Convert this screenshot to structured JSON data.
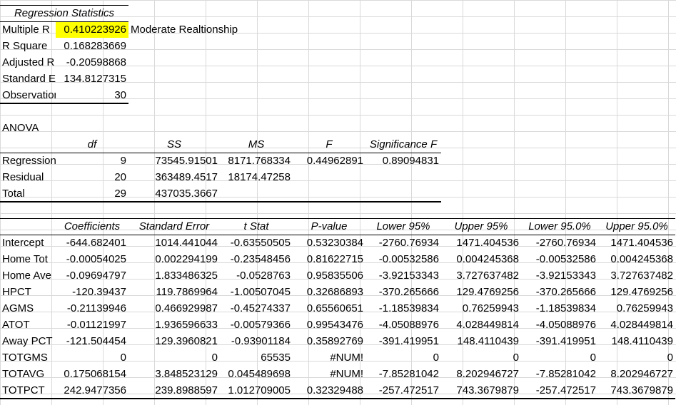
{
  "regression_statistics": {
    "title": "Regression Statistics",
    "rows": [
      {
        "label": "Multiple R",
        "value": "0.410223926",
        "note": "Moderate Realtionship"
      },
      {
        "label": "R Square",
        "value": "0.168283669"
      },
      {
        "label": "Adjusted R Square",
        "value": "-0.20598868"
      },
      {
        "label": "Standard Error",
        "value": "134.8127315"
      },
      {
        "label": "Observations",
        "value": "30"
      }
    ]
  },
  "anova": {
    "title": "ANOVA",
    "headers": [
      "df",
      "SS",
      "MS",
      "F",
      "Significance F"
    ],
    "rows": [
      {
        "label": "Regression",
        "df": "9",
        "ss": "73545.91501",
        "ms": "8171.768334",
        "f": "0.44962891",
        "sig": "0.89094831"
      },
      {
        "label": "Residual",
        "df": "20",
        "ss": "363489.4517",
        "ms": "18174.47258"
      },
      {
        "label": "Total",
        "df": "29",
        "ss": "437035.3667"
      }
    ]
  },
  "coefficients": {
    "headers": [
      "Coefficients",
      "Standard Error",
      "t Stat",
      "P-value",
      "Lower 95%",
      "Upper 95%",
      "Lower 95.0%",
      "Upper 95.0%"
    ],
    "rows": [
      {
        "label": "Intercept",
        "values": [
          "-644.682401",
          "1014.441044",
          "-0.63550505",
          "0.53230384",
          "-2760.76934",
          "1471.404536",
          "-2760.76934",
          "1471.404536"
        ]
      },
      {
        "label": "Home Tot",
        "values": [
          "-0.00054025",
          "0.002294199",
          "-0.23548456",
          "0.81622715",
          "-0.00532586",
          "0.004245368",
          "-0.00532586",
          "0.004245368"
        ]
      },
      {
        "label": "Home Ave",
        "values": [
          "-0.09694797",
          "1.833486325",
          "-0.0528763",
          "0.95835506",
          "-3.92153343",
          "3.727637482",
          "-3.92153343",
          "3.727637482"
        ]
      },
      {
        "label": "HPCT",
        "values": [
          "-120.39437",
          "119.7869964",
          "-1.00507045",
          "0.32686893",
          "-370.265666",
          "129.4769256",
          "-370.265666",
          "129.4769256"
        ]
      },
      {
        "label": "AGMS",
        "values": [
          "-0.21139946",
          "0.466929987",
          "-0.45274337",
          "0.65560651",
          "-1.18539834",
          "0.76259943",
          "-1.18539834",
          "0.76259943"
        ]
      },
      {
        "label": "ATOT",
        "values": [
          "-0.01121997",
          "1.936596633",
          "-0.00579366",
          "0.99543476",
          "-4.05088976",
          "4.028449814",
          "-4.05088976",
          "4.028449814"
        ]
      },
      {
        "label": "Away PCT",
        "values": [
          "-121.504454",
          "129.3960821",
          "-0.93901184",
          "0.35892769",
          "-391.419951",
          "148.4110439",
          "-391.419951",
          "148.4110439"
        ]
      },
      {
        "label": "TOTGMS",
        "values": [
          "0",
          "0",
          "65535",
          "#NUM!",
          "0",
          "0",
          "0",
          "0"
        ]
      },
      {
        "label": "TOTAVG",
        "values": [
          "0.175068154",
          "3.848523129",
          "0.045489698",
          "#NUM!",
          "-7.85281042",
          "8.202946727",
          "-7.85281042",
          "8.202946727"
        ]
      },
      {
        "label": "TOTPCT",
        "values": [
          "242.9477356",
          "239.8988597",
          "1.012709005",
          "0.32329488",
          "-257.472517",
          "743.3679879",
          "-257.472517",
          "743.3679879"
        ]
      }
    ]
  }
}
